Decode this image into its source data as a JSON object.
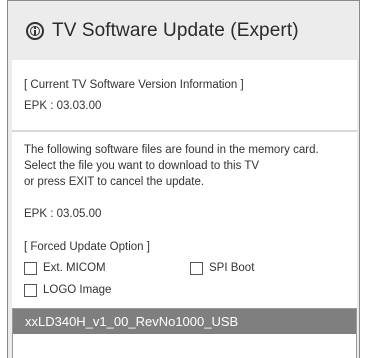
{
  "dialog": {
    "title": "TV Software Update (Expert)",
    "title_icon": "info-icon"
  },
  "current": {
    "header": "[ Current TV Software Version Information ]",
    "epk": "EPK : 03.03.00"
  },
  "found": {
    "line1": "The following software files are found in the memory card.",
    "line2": "Select the file you want to download to this TV",
    "line3": "or press EXIT to cancel the update.",
    "epk": "EPK : 03.05.00"
  },
  "forced": {
    "header": "[ Forced Update Option ]",
    "options": [
      {
        "label": "Ext. MICOM",
        "checked": false
      },
      {
        "label": "SPI Boot",
        "checked": false
      },
      {
        "label": "LOGO Image",
        "checked": false
      }
    ]
  },
  "files": [
    {
      "name": "xxLD340H_v1_00_RevNo1000_USB",
      "selected": true
    }
  ]
}
